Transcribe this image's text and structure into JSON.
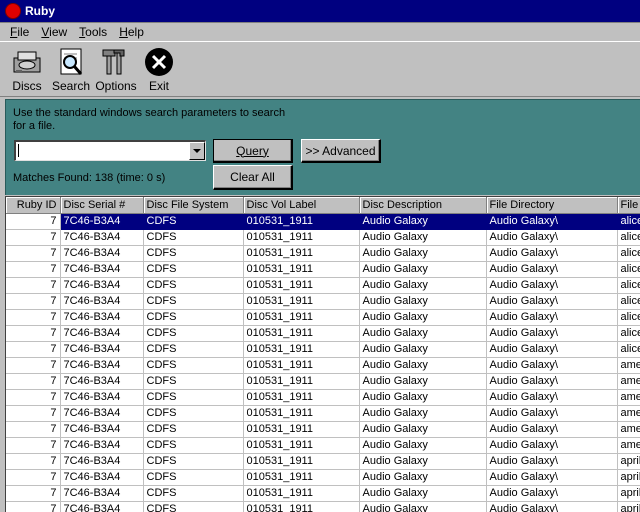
{
  "window": {
    "title": "Ruby"
  },
  "menu": [
    {
      "label": "File",
      "accel": "F",
      "rest": "ile"
    },
    {
      "label": "View",
      "accel": "V",
      "rest": "iew"
    },
    {
      "label": "Tools",
      "accel": "T",
      "rest": "ools"
    },
    {
      "label": "Help",
      "accel": "H",
      "rest": "elp"
    }
  ],
  "toolbar": {
    "discs": {
      "label": "Discs",
      "icon": "discs-icon"
    },
    "search": {
      "label": "Search",
      "icon": "search-icon"
    },
    "options": {
      "label": "Options",
      "icon": "options-icon"
    },
    "exit": {
      "label": "Exit",
      "icon": "exit-icon"
    }
  },
  "search": {
    "hint": "Use the standard windows search parameters to search for a file.",
    "query_value": "",
    "query_label": "Query",
    "advanced_label": ">> Advanced",
    "clear_label": "Clear All",
    "matches": "Matches Found: 138 (time: 0 s)"
  },
  "grid": {
    "columns": [
      "Ruby ID",
      "Disc Serial #",
      "Disc File System",
      "Disc Vol Label",
      "Disc Description",
      "File Directory",
      "File N"
    ],
    "rows": [
      [
        "7",
        "7C46-B3A4",
        "CDFS",
        "010531_1911",
        "Audio Galaxy",
        "Audio Galaxy\\",
        "alice"
      ],
      [
        "7",
        "7C46-B3A4",
        "CDFS",
        "010531_1911",
        "Audio Galaxy",
        "Audio Galaxy\\",
        "alice"
      ],
      [
        "7",
        "7C46-B3A4",
        "CDFS",
        "010531_1911",
        "Audio Galaxy",
        "Audio Galaxy\\",
        "alice"
      ],
      [
        "7",
        "7C46-B3A4",
        "CDFS",
        "010531_1911",
        "Audio Galaxy",
        "Audio Galaxy\\",
        "alice"
      ],
      [
        "7",
        "7C46-B3A4",
        "CDFS",
        "010531_1911",
        "Audio Galaxy",
        "Audio Galaxy\\",
        "alice"
      ],
      [
        "7",
        "7C46-B3A4",
        "CDFS",
        "010531_1911",
        "Audio Galaxy",
        "Audio Galaxy\\",
        "alice"
      ],
      [
        "7",
        "7C46-B3A4",
        "CDFS",
        "010531_1911",
        "Audio Galaxy",
        "Audio Galaxy\\",
        "alice"
      ],
      [
        "7",
        "7C46-B3A4",
        "CDFS",
        "010531_1911",
        "Audio Galaxy",
        "Audio Galaxy\\",
        "alice"
      ],
      [
        "7",
        "7C46-B3A4",
        "CDFS",
        "010531_1911",
        "Audio Galaxy",
        "Audio Galaxy\\",
        "alice"
      ],
      [
        "7",
        "7C46-B3A4",
        "CDFS",
        "010531_1911",
        "Audio Galaxy",
        "Audio Galaxy\\",
        "ame"
      ],
      [
        "7",
        "7C46-B3A4",
        "CDFS",
        "010531_1911",
        "Audio Galaxy",
        "Audio Galaxy\\",
        "ame"
      ],
      [
        "7",
        "7C46-B3A4",
        "CDFS",
        "010531_1911",
        "Audio Galaxy",
        "Audio Galaxy\\",
        "ame"
      ],
      [
        "7",
        "7C46-B3A4",
        "CDFS",
        "010531_1911",
        "Audio Galaxy",
        "Audio Galaxy\\",
        "ame"
      ],
      [
        "7",
        "7C46-B3A4",
        "CDFS",
        "010531_1911",
        "Audio Galaxy",
        "Audio Galaxy\\",
        "ame"
      ],
      [
        "7",
        "7C46-B3A4",
        "CDFS",
        "010531_1911",
        "Audio Galaxy",
        "Audio Galaxy\\",
        "ame"
      ],
      [
        "7",
        "7C46-B3A4",
        "CDFS",
        "010531_1911",
        "Audio Galaxy",
        "Audio Galaxy\\",
        "april"
      ],
      [
        "7",
        "7C46-B3A4",
        "CDFS",
        "010531_1911",
        "Audio Galaxy",
        "Audio Galaxy\\",
        "april"
      ],
      [
        "7",
        "7C46-B3A4",
        "CDFS",
        "010531_1911",
        "Audio Galaxy",
        "Audio Galaxy\\",
        "april"
      ],
      [
        "7",
        "7C46-B3A4",
        "CDFS",
        "010531_1911",
        "Audio Galaxy",
        "Audio Galaxy\\",
        "april"
      ]
    ],
    "selected_row": 0
  },
  "colors": {
    "title_bar": "#000080",
    "panel": "#438383",
    "face": "#c0c0c0",
    "selection": "#000080"
  }
}
